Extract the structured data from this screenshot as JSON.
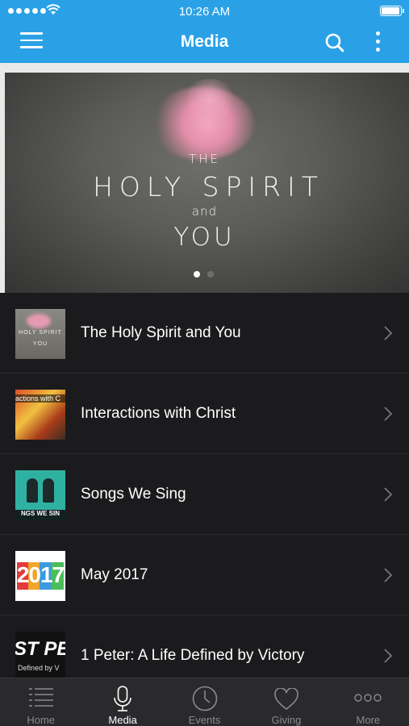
{
  "status_bar": {
    "time": "10:26 AM"
  },
  "nav": {
    "title": "Media"
  },
  "hero": {
    "line1": "THE",
    "line2": "HOLY SPIRIT",
    "line3": "and",
    "line4": "YOU",
    "pages": 2,
    "current_page": 1
  },
  "media_list": [
    {
      "title": "The Holy Spirit and You",
      "thumb_text_1": "HOLY SPIRIT",
      "thumb_text_2": "YOU"
    },
    {
      "title": "Interactions with Christ",
      "thumb_text": "actions with C"
    },
    {
      "title": "Songs We Sing",
      "thumb_text": "NGS WE SIN"
    },
    {
      "title": "May 2017",
      "thumb_text": "2017"
    },
    {
      "title": "1 Peter: A Life Defined by Victory",
      "thumb_text_1": "ST PE",
      "thumb_text_2": "Defined by V"
    }
  ],
  "tab_bar": [
    {
      "label": "Home",
      "icon": "list-icon"
    },
    {
      "label": "Media",
      "icon": "microphone-icon",
      "active": true
    },
    {
      "label": "Events",
      "icon": "clock-icon"
    },
    {
      "label": "Giving",
      "icon": "heart-icon"
    },
    {
      "label": "More",
      "icon": "more-dots-icon"
    }
  ],
  "colors": {
    "accent": "#2aa1e6",
    "background": "#1b1b1d",
    "tab_bar": "#2a2a2d"
  }
}
